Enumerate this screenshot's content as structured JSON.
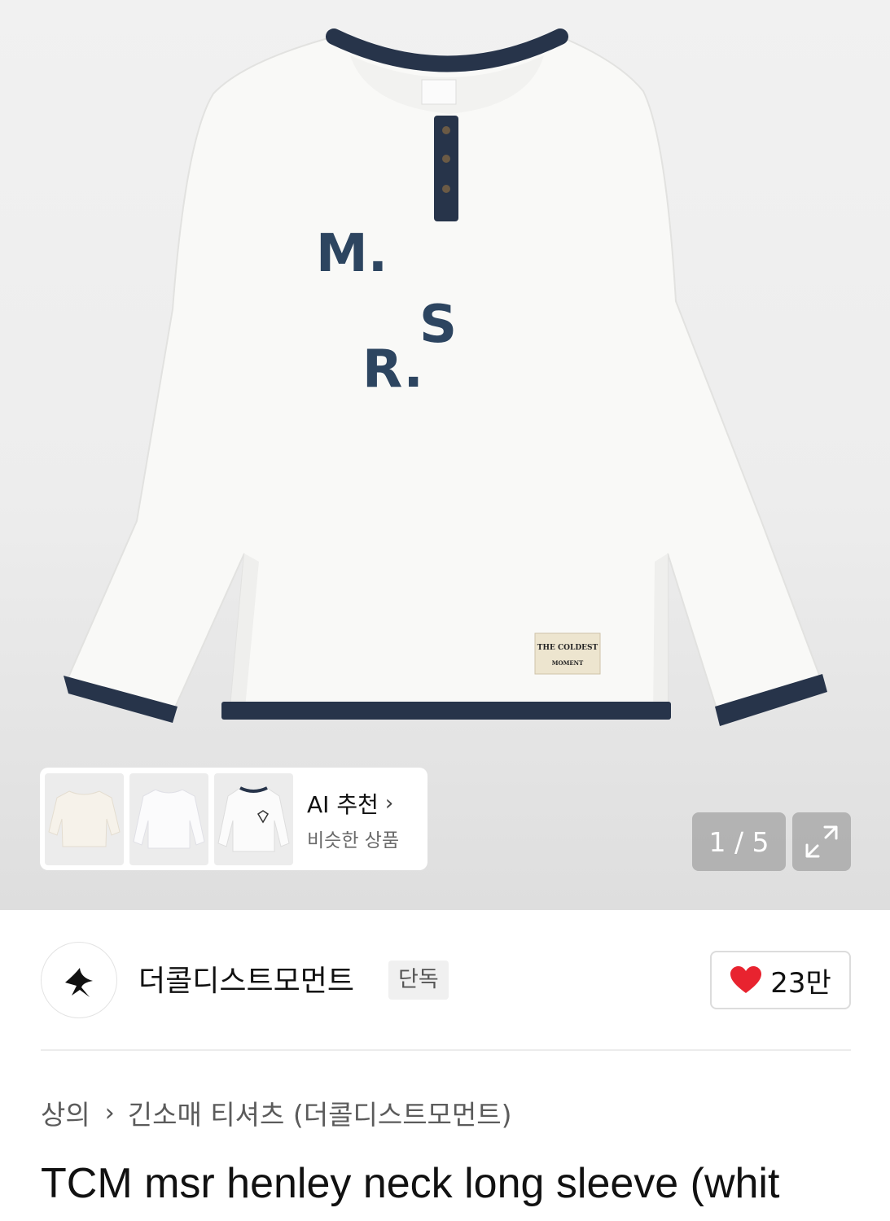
{
  "gallery": {
    "counter": "1 / 5",
    "label_brand_top": "THE COLDEST",
    "label_brand_bottom": "MOMENT",
    "print_letters": [
      "M.",
      "S",
      "R."
    ]
  },
  "ai_recommend": {
    "title": "AI 추천",
    "subtitle": "비슷한 상품"
  },
  "brand": {
    "name": "더콜디스트모먼트",
    "badge": "단독"
  },
  "like": {
    "count": "23만",
    "color": "#e8232f"
  },
  "breadcrumb": {
    "category": "상의",
    "subcategory": "긴소매 티셔츠 (더콜디스트모먼트)"
  },
  "product": {
    "title": "TCM msr henley neck long sleeve (whit"
  },
  "colors": {
    "navy_trim": "#27344a",
    "shirt_white": "#f9f9f7"
  }
}
